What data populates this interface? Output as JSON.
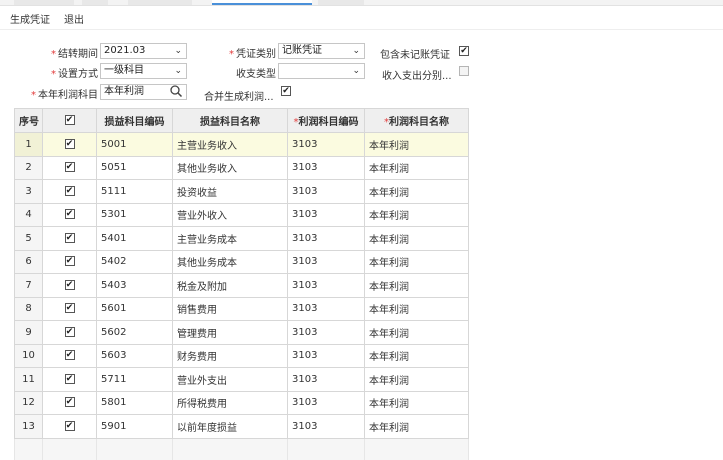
{
  "toolbar": {
    "generate_label": "生成凭证",
    "exit_label": "退出"
  },
  "form": {
    "period_label": "结转期间",
    "period_value": "2021.03",
    "voucher_type_label": "凭证类别",
    "voucher_type_value": "记账凭证",
    "include_unposted_label": "包含未记账凭证",
    "include_unposted_checked": true,
    "setup_method_label": "设置方式",
    "setup_method_value": "一级科目",
    "income_expense_type_label": "收支类型",
    "income_expense_type_value": "",
    "split_income_expense_label": "收入支出分别...",
    "split_income_expense_checked": false,
    "profit_account_label": "本年利润科目",
    "profit_account_value": "本年利润",
    "merge_generate_label": "合并生成利润...",
    "merge_generate_checked": true
  },
  "grid": {
    "headers": {
      "no": "序号",
      "check": "✔",
      "pl_code": "损益科目编码",
      "pl_name": "损益科目名称",
      "profit_code": "利润科目编码",
      "profit_name": "利润科目名称"
    },
    "rows": [
      {
        "no": "1",
        "pl_code": "5001",
        "pl_name": "主营业务收入",
        "profit_code": "3103",
        "profit_name": "本年利润"
      },
      {
        "no": "2",
        "pl_code": "5051",
        "pl_name": "其他业务收入",
        "profit_code": "3103",
        "profit_name": "本年利润"
      },
      {
        "no": "3",
        "pl_code": "5111",
        "pl_name": "投资收益",
        "profit_code": "3103",
        "profit_name": "本年利润"
      },
      {
        "no": "4",
        "pl_code": "5301",
        "pl_name": "营业外收入",
        "profit_code": "3103",
        "profit_name": "本年利润"
      },
      {
        "no": "5",
        "pl_code": "5401",
        "pl_name": "主营业务成本",
        "profit_code": "3103",
        "profit_name": "本年利润"
      },
      {
        "no": "6",
        "pl_code": "5402",
        "pl_name": "其他业务成本",
        "profit_code": "3103",
        "profit_name": "本年利润"
      },
      {
        "no": "7",
        "pl_code": "5403",
        "pl_name": "税金及附加",
        "profit_code": "3103",
        "profit_name": "本年利润"
      },
      {
        "no": "8",
        "pl_code": "5601",
        "pl_name": "销售费用",
        "profit_code": "3103",
        "profit_name": "本年利润"
      },
      {
        "no": "9",
        "pl_code": "5602",
        "pl_name": "管理费用",
        "profit_code": "3103",
        "profit_name": "本年利润"
      },
      {
        "no": "10",
        "pl_code": "5603",
        "pl_name": "财务费用",
        "profit_code": "3103",
        "profit_name": "本年利润"
      },
      {
        "no": "11",
        "pl_code": "5711",
        "pl_name": "营业外支出",
        "profit_code": "3103",
        "profit_name": "本年利润"
      },
      {
        "no": "12",
        "pl_code": "5801",
        "pl_name": "所得税费用",
        "profit_code": "3103",
        "profit_name": "本年利润"
      },
      {
        "no": "13",
        "pl_code": "5901",
        "pl_name": "以前年度损益",
        "profit_code": "3103",
        "profit_name": "本年利润"
      }
    ],
    "selected_row": 0,
    "row_checkmark": "✔"
  },
  "icons": {
    "dropdown": "chevron-down-icon",
    "lookup": "search-icon",
    "check": "checkmark-icon"
  },
  "colors": {
    "selected_row": "#fbfbe0",
    "header_bg": "#efefef",
    "required_mark": "#e23a3a"
  }
}
